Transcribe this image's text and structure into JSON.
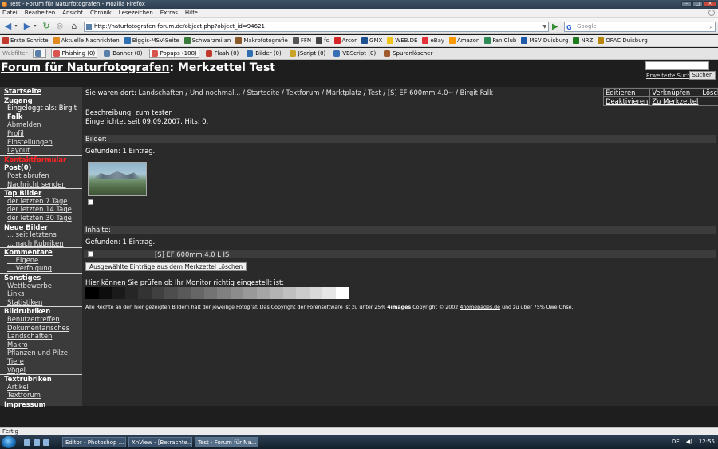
{
  "window": {
    "title": "Test - Forum für Naturfotografen - Mozilla Firefox"
  },
  "menu": [
    "Datei",
    "Bearbeiten",
    "Ansicht",
    "Chronik",
    "Lesezeichen",
    "Extras",
    "Hilfe"
  ],
  "navbar": {
    "url": "http://naturfotografen-forum.de/object.php?object_id=94621",
    "search_placeholder": "Google"
  },
  "bookmarks": [
    {
      "label": "Erste Schritte",
      "color": "#c0392b"
    },
    {
      "label": "Aktuelle Nachrichten",
      "color": "#e08a1e"
    },
    {
      "label": "Biggis-MSV-Seite",
      "color": "#2f6fb0"
    },
    {
      "label": "Schwarzmilan",
      "color": "#3a7a3a"
    },
    {
      "label": "Makrofotografie",
      "color": "#8a5a2b"
    },
    {
      "label": "FFN",
      "color": "#555555"
    },
    {
      "label": "fc",
      "color": "#444444"
    },
    {
      "label": "Arcor",
      "color": "#d42626"
    },
    {
      "label": "GMX",
      "color": "#1d4f91"
    },
    {
      "label": "WEB.DE",
      "color": "#f0c419"
    },
    {
      "label": "eBay",
      "color": "#e53238"
    },
    {
      "label": "Amazon",
      "color": "#ff9900"
    },
    {
      "label": "Fan Club",
      "color": "#2e8b57"
    },
    {
      "label": "MSV Duisburg",
      "color": "#1e5aa8"
    },
    {
      "label": "NRZ",
      "color": "#1f7a1f"
    },
    {
      "label": "OPAC Duisburg",
      "color": "#b8860b"
    }
  ],
  "webfilter": {
    "label": "Webfilter",
    "items": [
      {
        "label": "Phishing (0)",
        "boxed": true,
        "color": "#d9534f"
      },
      {
        "label": "Banner (0)",
        "boxed": false,
        "color": "#5a7fa8"
      },
      {
        "label": "Popups (108)",
        "boxed": true,
        "color": "#d9534f"
      },
      {
        "label": "Flash (0)",
        "boxed": false,
        "color": "#c0392b"
      },
      {
        "label": "Bilder (0)",
        "boxed": false,
        "color": "#2f6fb0"
      },
      {
        "label": "JScript (0)",
        "boxed": false,
        "color": "#c9a227"
      },
      {
        "label": "VBScript (0)",
        "boxed": false,
        "color": "#3a6fb8"
      },
      {
        "label": "Spurenlöscher",
        "boxed": false,
        "color": "#a05a2c"
      }
    ]
  },
  "header": {
    "forum_link": "Forum für Naturfotografen",
    "page_title": ": Merkzettel Test",
    "advanced_search": "Erweiterte Suche",
    "search_button": "Suchen"
  },
  "sidebar": {
    "items": [
      {
        "text": "Startseite",
        "kind": "hd-link"
      },
      {
        "text": "Zugang",
        "kind": "hd"
      },
      {
        "text": "Eingeloggt als: Birgit",
        "kind": "tx"
      },
      {
        "text": "Falk",
        "kind": "tx-bold"
      },
      {
        "text": "Abmelden",
        "kind": "it"
      },
      {
        "text": "Profil",
        "kind": "it"
      },
      {
        "text": "Einstellungen",
        "kind": "it"
      },
      {
        "text": "Layout",
        "kind": "it"
      },
      {
        "text": "Kontaktformular",
        "kind": "red"
      },
      {
        "text": "Post(0)",
        "kind": "hd-link"
      },
      {
        "text": "Post abrufen",
        "kind": "it"
      },
      {
        "text": "Nachricht senden",
        "kind": "it"
      },
      {
        "text": "Top Bilder",
        "kind": "hd-link"
      },
      {
        "text": "der letzten 7 Tage",
        "kind": "it"
      },
      {
        "text": "der letzten 14 Tage",
        "kind": "it"
      },
      {
        "text": "der letzten 30 Tage",
        "kind": "it"
      },
      {
        "text": "Neue Bilder",
        "kind": "hd-link"
      },
      {
        "text": "... seit letztens",
        "kind": "it"
      },
      {
        "text": "... nach Rubriken",
        "kind": "it"
      },
      {
        "text": "Kommentare",
        "kind": "hd-link"
      },
      {
        "text": "... Eigene",
        "kind": "it"
      },
      {
        "text": "... Verfolgung",
        "kind": "it"
      },
      {
        "text": "Sonstiges",
        "kind": "hd"
      },
      {
        "text": "Wettbewerbe",
        "kind": "it"
      },
      {
        "text": "Links",
        "kind": "it"
      },
      {
        "text": "Statistiken",
        "kind": "it"
      },
      {
        "text": "Bildrubriken",
        "kind": "hd"
      },
      {
        "text": "Benutzertreffen",
        "kind": "it"
      },
      {
        "text": "Dokumentarisches",
        "kind": "it"
      },
      {
        "text": "Landschaften",
        "kind": "it"
      },
      {
        "text": "Makro",
        "kind": "it"
      },
      {
        "text": "Pflanzen und Pilze",
        "kind": "it"
      },
      {
        "text": "Tiere",
        "kind": "it"
      },
      {
        "text": "Vögel",
        "kind": "it"
      },
      {
        "text": "Textrubriken",
        "kind": "hd"
      },
      {
        "text": "Artikel",
        "kind": "it"
      },
      {
        "text": "Textforum",
        "kind": "it"
      },
      {
        "text": "Impressum",
        "kind": "hd-link"
      }
    ]
  },
  "breadcrumb": {
    "prefix": "Sie waren dort:",
    "sep": "/",
    "links": [
      "Landschaften",
      "Und nochmal...",
      "Startseite",
      "Textforum",
      "Marktplatz",
      "Test",
      "[S] EF 600mm 4.0~",
      "Birgit Falk"
    ]
  },
  "actions": {
    "edit": "Editieren",
    "links": "Verknüpfen",
    "delete": "Löschen",
    "deactivate": "Deaktivieren",
    "to_notepad": "Zu Merkzettel"
  },
  "content": {
    "description": "Beschreibung: zum testen",
    "created": "Eingerichtet seit 09.09.2007. Hits: 0.",
    "images_header": "Bilder:",
    "images_found": "Gefunden: 1 Eintrag.",
    "contents_header": "Inhalte:",
    "contents_found": "Gefunden: 1 Eintrag.",
    "entry_link": "[S] EF 600mm 4.0 L IS",
    "delete_button": "Ausgewählte Einträge aus dem Merkzettel Löschen",
    "monitor_text": "Hier können Sie prüfen ob Ihr Monitor richtig eingestellt ist:"
  },
  "footer": {
    "part1": "Alle Rechte an den hier gezeigten Bildern hält der jeweilige Fotograf. Das Copyright der Forensoftware ist zu unter 25%",
    "brand": "4images",
    "part2": "Copyright © 2002",
    "link": "4homepages.de",
    "part3": "und zu über 75% Uwe Ohse."
  },
  "statusbar": {
    "text": "Fertig"
  },
  "taskbar": {
    "tasks": [
      "Editor - Photoshop ...",
      "XnView - [Betrachte...",
      "Test - Forum für Na..."
    ],
    "tray": {
      "lang": "DE",
      "time": "12:55"
    }
  }
}
